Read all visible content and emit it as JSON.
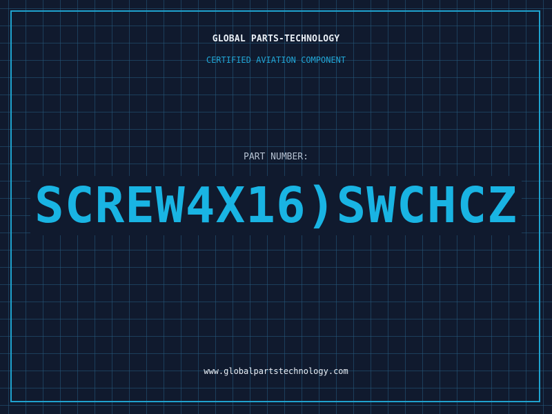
{
  "header": {
    "company_name": "GLOBAL PARTS-TECHNOLOGY",
    "subtitle": "CERTIFIED AVIATION COMPONENT"
  },
  "part": {
    "label": "PART NUMBER:",
    "number": "SCREW4X16)SWCHCZ"
  },
  "footer": {
    "website": "www.globalpartstechnology.com"
  },
  "colors": {
    "background": "#101a2e",
    "grid": "#265c80",
    "accent": "#19b4e3",
    "frame": "#1fa3cf",
    "text": "#e8eef5",
    "muted_text": "#b6c2d2"
  }
}
